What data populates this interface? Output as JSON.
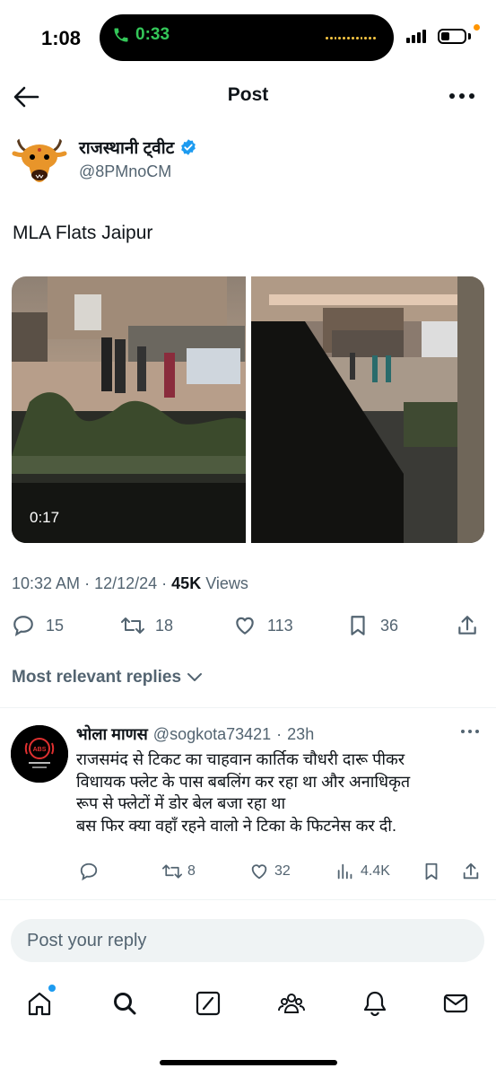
{
  "status_bar": {
    "time": "1:08",
    "call_timer": "0:33"
  },
  "header": {
    "title": "Post"
  },
  "tweet": {
    "author_name": "राजस्थानी ट्वीट",
    "author_handle": "@8PMnoCM",
    "text": "MLA Flats Jaipur",
    "video_duration": "0:17",
    "time": "10:32 AM",
    "date": "12/12/24",
    "views_count": "45K",
    "views_label": "Views",
    "replies": "15",
    "reposts": "18",
    "likes": "113",
    "bookmarks": "36"
  },
  "replies_sort": {
    "label": "Most relevant replies"
  },
  "reply": {
    "author_name": "भोला माणस",
    "author_handle": "@sogkota73421",
    "time": "23h",
    "avatar_text": "ABS",
    "body_lines": [
      "राजसमंद से टिकट का चाहवान कार्तिक चौधरी दारू पीकर",
      "विधायक फ्लेट के पास बबलिंग कर रहा था और अनाधिकृत",
      "रूप से फ्लेटों में डोर बेल बजा रहा था",
      "बस फिर क्या वहाँ रहने वालो ने टिका के फिटनेस कर दी."
    ],
    "reposts": "8",
    "likes": "32",
    "views": "4.4K"
  },
  "compose": {
    "placeholder": "Post your reply"
  },
  "colors": {
    "text": "#0f1419",
    "secondary": "#536471",
    "accent": "#1d9bf0",
    "call_green": "#34c759"
  },
  "icons": {
    "back": "arrow-left-icon",
    "more": "more-horizontal-icon",
    "verified": "verified-badge-icon",
    "reply": "comment-icon",
    "repost": "repost-icon",
    "like": "heart-icon",
    "bookmark": "bookmark-icon",
    "share": "share-icon",
    "views": "analytics-icon",
    "nav": [
      "home-icon",
      "search-icon",
      "grok-icon",
      "communities-icon",
      "notifications-icon",
      "messages-icon"
    ]
  }
}
